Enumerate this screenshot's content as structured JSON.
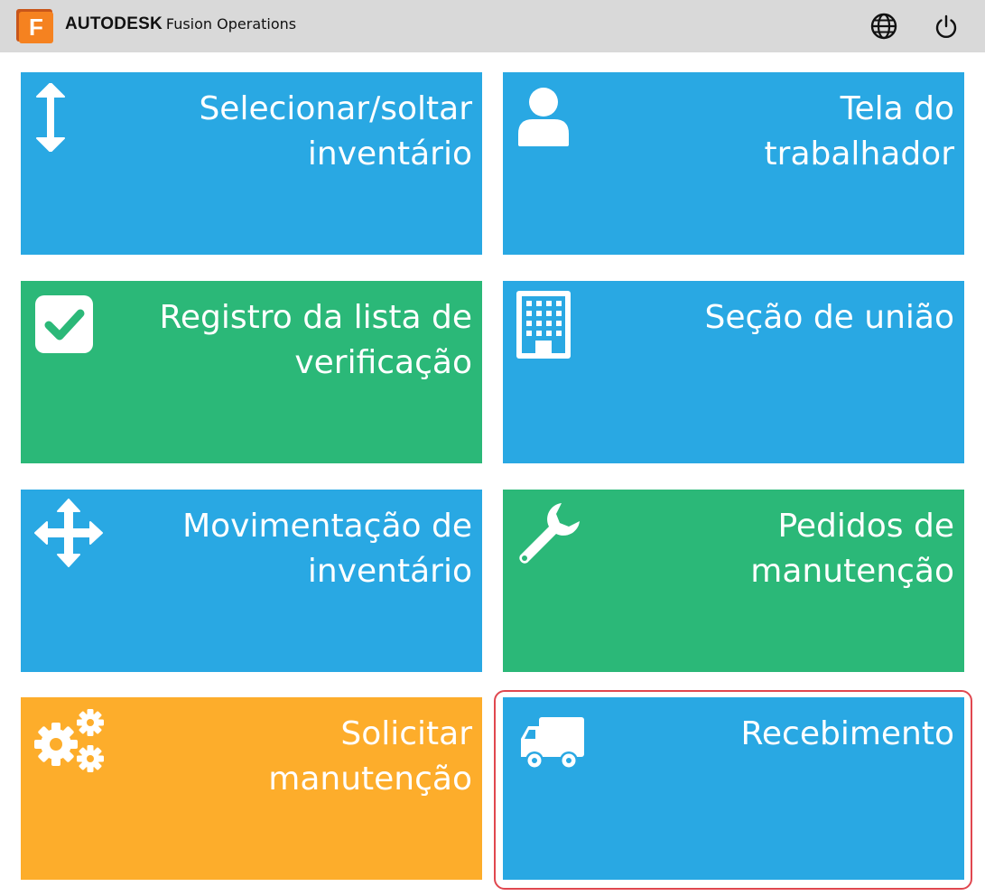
{
  "header": {
    "brand_bold": "AUTODESK",
    "brand_product": "Fusion Operations",
    "logo_letter": "F",
    "globe_icon": "globe-icon",
    "power_icon": "power-icon"
  },
  "colors": {
    "blue": "#29a8e3",
    "green": "#2bb878",
    "orange": "#fdad2b",
    "header_bg": "#d9d9d9",
    "highlight": "#e0474f",
    "logo_orange": "#f58220"
  },
  "tiles": [
    {
      "label": "Selecionar/soltar\ninventário",
      "icon": "vertical-arrows-icon",
      "color": "blue"
    },
    {
      "label": "Tela do\ntrabalhador",
      "icon": "user-icon",
      "color": "blue"
    },
    {
      "label": "Registro da lista de\nverificação",
      "icon": "checkbox-icon",
      "color": "green"
    },
    {
      "label": "Seção de união",
      "icon": "building-icon",
      "color": "blue"
    },
    {
      "label": "Movimentação de\ninventário",
      "icon": "move-arrows-icon",
      "color": "blue"
    },
    {
      "label": "Pedidos de\nmanutenção",
      "icon": "wrench-icon",
      "color": "green"
    },
    {
      "label": "Solicitar\nmanutenção",
      "icon": "gears-icon",
      "color": "orange"
    },
    {
      "label": "Recebimento",
      "icon": "truck-icon",
      "color": "blue",
      "highlighted": true
    }
  ]
}
